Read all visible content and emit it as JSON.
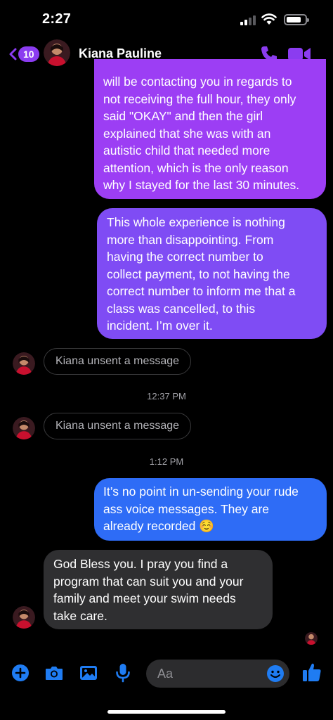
{
  "status_bar": {
    "time": "2:27"
  },
  "header": {
    "back_count": "10",
    "contact_name": "Kiana Pauline"
  },
  "messages": [
    {
      "sender": "contact",
      "text": "will be contacting you in regards to\nnot receiving the full hour, they only\nsaid \"OKAY\" and then the girl\nexplained that she was with an\nautistic child that needed more\nattention, which is the only reason\nwhy I stayed for the last 30 minutes."
    },
    {
      "sender": "me",
      "text": "This whole experience is nothing\nmore than disappointing. From\nhaving the correct number to\ncollect payment, to not having the\ncorrect number to inform me that a\nclass was cancelled, to this\nincident. I’m over it."
    },
    {
      "sender": "contact",
      "text": "Kiana unsent a message"
    },
    {
      "timestamp": "12:37 PM"
    },
    {
      "sender": "contact",
      "text": "Kiana unsent a message"
    },
    {
      "timestamp": "1:12 PM"
    },
    {
      "sender": "me",
      "text": "It’s no point in un-sending your rude\nass voice messages. They are\nalready recorded ☺️"
    },
    {
      "sender": "contact",
      "text": "God Bless you. I pray you find a\nprogram that can suit you and your\nfamily and meet your swim needs\ntake care."
    }
  ],
  "composer": {
    "placeholder": "Aa"
  },
  "colors": {
    "accent": "#8b3cf0",
    "bubble_purple": "#9c3ef4",
    "bubble_violet": "#7f4cf4",
    "bubble_blue": "#2e6cf6",
    "bubble_gray": "#2f2f31",
    "composer_icon": "#1f7cf2"
  },
  "icons": {
    "back": "chevron-left-icon",
    "call": "phone-icon",
    "video": "video-camera-icon",
    "plus": "plus-circle-icon",
    "camera": "camera-icon",
    "gallery": "photo-icon",
    "mic": "microphone-icon",
    "emoji": "smiley-icon",
    "like": "thumbs-up-icon"
  }
}
